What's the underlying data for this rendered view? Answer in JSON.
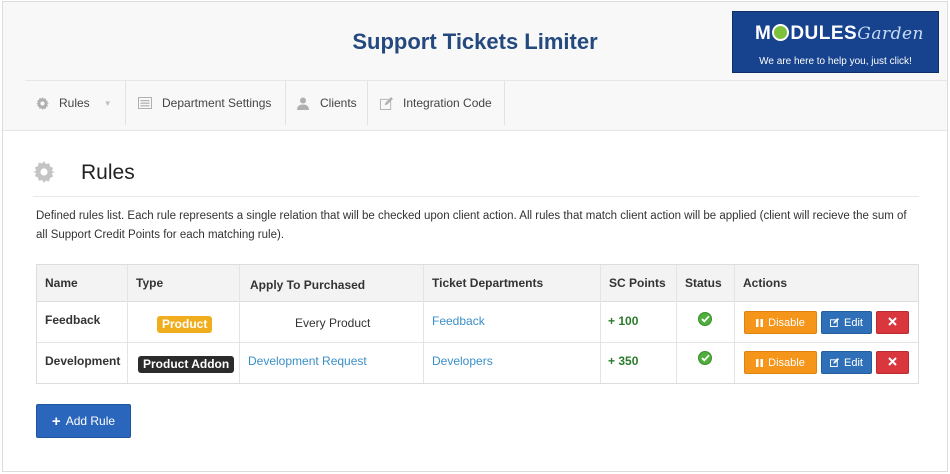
{
  "app": {
    "title": "Support Tickets Limiter"
  },
  "logo": {
    "brand_a": "M",
    "brand_b": "DULES",
    "brand_c": "Garden",
    "tagline": "We are here to help you, just click!"
  },
  "nav": {
    "items": [
      {
        "label": "Rules",
        "icon": "gear-icon"
      },
      {
        "label": "Department Settings",
        "icon": "list-icon"
      },
      {
        "label": "Clients",
        "icon": "user-icon"
      },
      {
        "label": "Integration Code",
        "icon": "edit-icon"
      }
    ]
  },
  "section": {
    "title": "Rules",
    "description": "Defined rules list. Each rule represents a single relation that will be checked upon client action. All rules that match client action will be applied (client will recieve the sum of all Support Credit Points for each matching rule)."
  },
  "table": {
    "headers": [
      "Name",
      "Type",
      "Apply To Purchased",
      "Ticket Departments",
      "SC Points",
      "Status",
      "Actions"
    ],
    "rows": [
      {
        "name": "Feedback",
        "type": "Product",
        "apply_to": "Every Product",
        "department": "Feedback",
        "points": "+ 100",
        "status": "active"
      },
      {
        "name": "Development",
        "type": "Product Addon",
        "apply_to": "Development Request",
        "department": "Developers",
        "points": "+ 350",
        "status": "active"
      }
    ],
    "actions": {
      "disable": "Disable",
      "edit": "Edit"
    }
  },
  "add_rule": {
    "label": "Add Rule"
  },
  "colors": {
    "title": "#24497e",
    "link": "#3a8fc8",
    "disable": "#f5951a",
    "edit": "#2f6fb7",
    "delete": "#d9363e",
    "add": "#2a66bb",
    "badge_product": "#f0ad1e",
    "badge_addon": "#2b2b2b"
  }
}
